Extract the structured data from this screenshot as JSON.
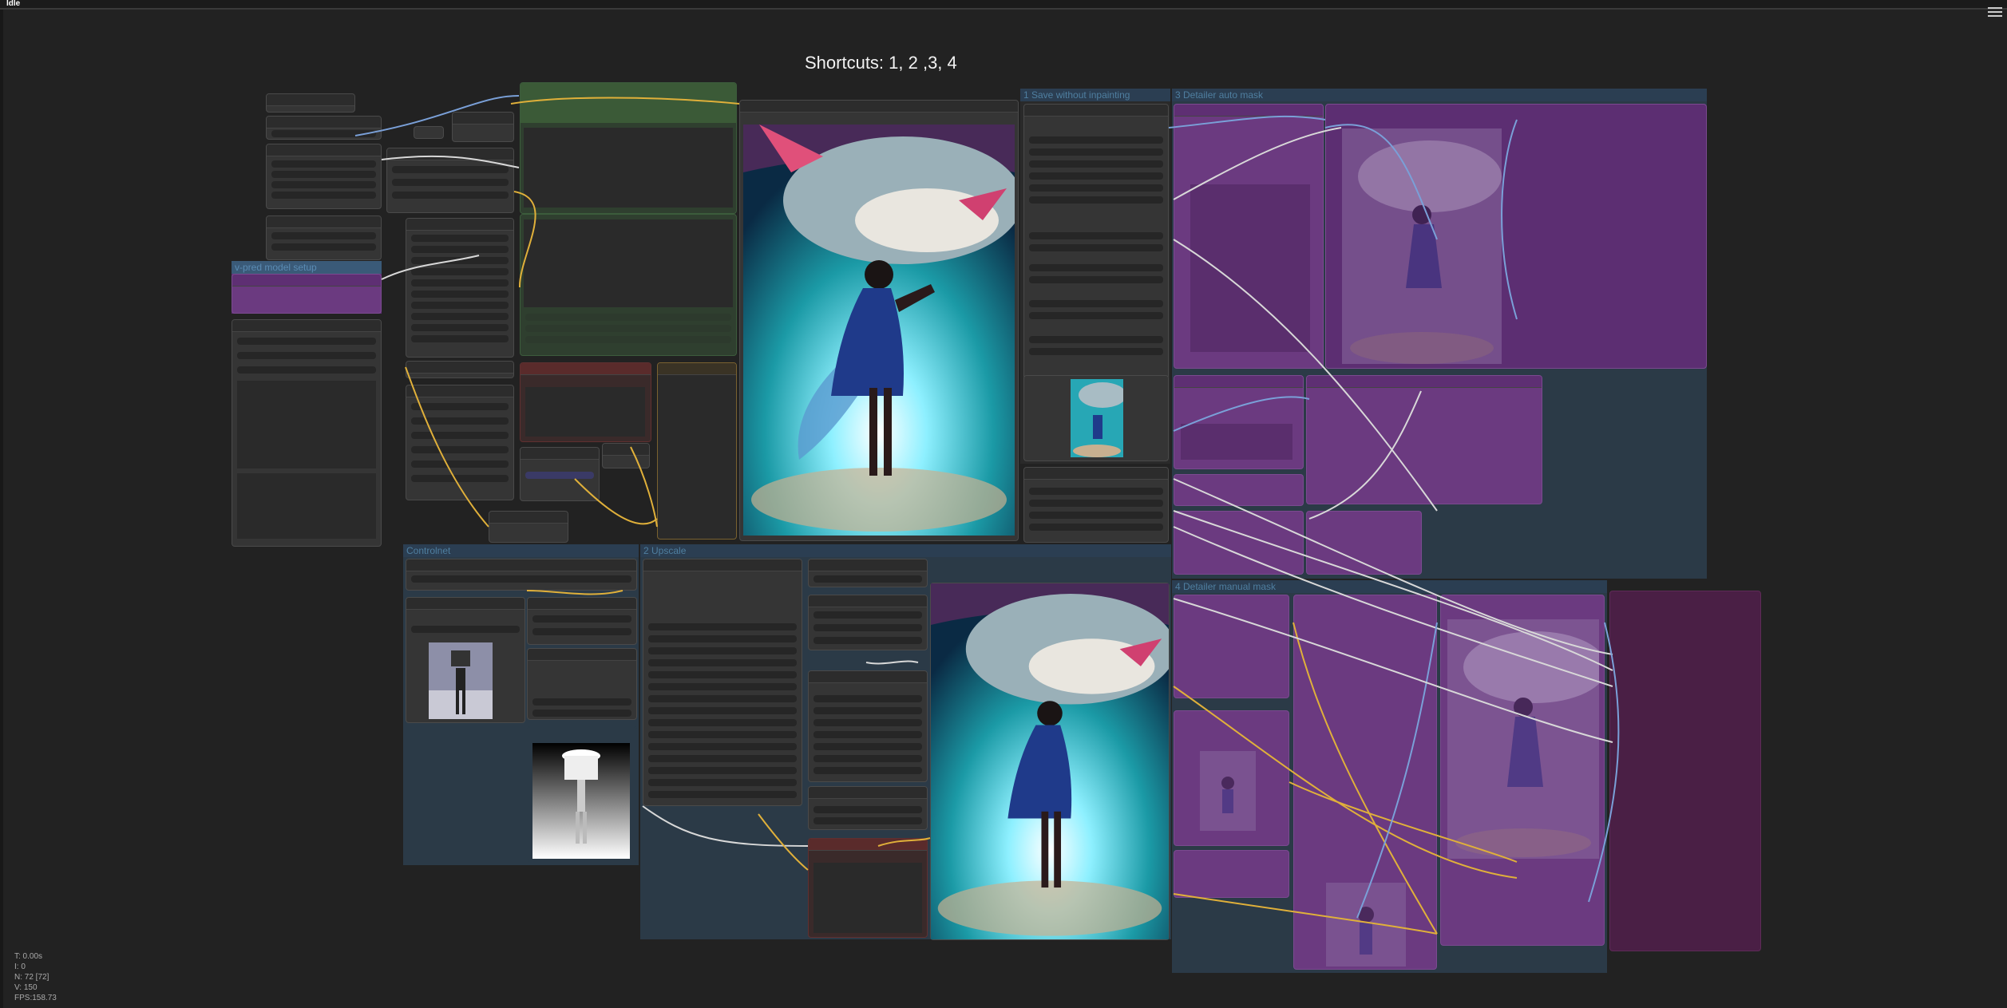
{
  "app": {
    "status": "Idle",
    "menu_icon": "hamburger-menu-icon"
  },
  "canvas": {
    "note": "Shortcuts: 1, 2 ,3, 4"
  },
  "groups": {
    "vpred": "v-pred model setup",
    "save": "1 Save without inpainting",
    "detailer_auto": "3 Detailer auto mask",
    "controlnet": "Controlnet",
    "upscale": "2 Upscale",
    "detailer_manual": "4 Detailer manual mask"
  },
  "stats": {
    "t": "T: 0.00s",
    "i": "I: 0",
    "n": "N: 72 [72]",
    "v": "V: 150",
    "fps": "FPS:158.73"
  },
  "colors": {
    "purple_group": "#5b2d6e",
    "purple_node": "#6b3a80",
    "blue_group": "#2b3a47",
    "green_node": "#2f4a2f",
    "link_yellow": "#e0b03a",
    "link_blue": "#7aa0d8",
    "link_white": "#d8d8d8"
  }
}
